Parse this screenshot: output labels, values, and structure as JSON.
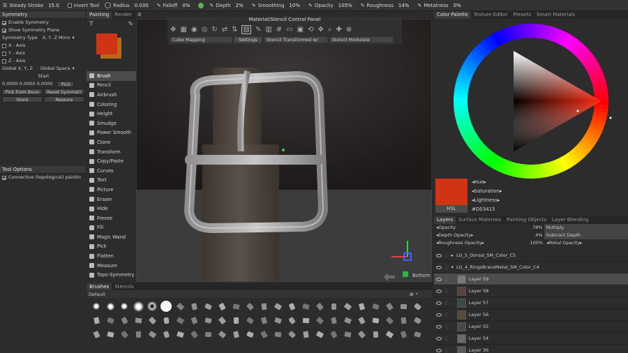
{
  "topbar": {
    "steady_stroke": "Steady Stroke",
    "steady_value": "15.0",
    "invert_tool": "Invert Tool",
    "radius_label": "Radius",
    "radius_value": "0.030",
    "falloff_label": "Falloff",
    "falloff_value": "0%",
    "depth_label": "Depth",
    "depth_value": "2%",
    "smoothing_label": "Smoothing",
    "smoothing_value": "10%",
    "opacity_label": "Opacity",
    "opacity_value": "105%",
    "roughness_label": "Roughness",
    "roughness_value": "14%",
    "metalness_label": "Metalness",
    "metalness_value": "0%"
  },
  "symmetry": {
    "title": "Symmetry",
    "enable": "Enable Symmetry",
    "show_plane": "Show Symmetry Plane",
    "type_label": "Symmetry Type",
    "type_value": "X, Y, Z Mirro",
    "x_axis": "X - Axis",
    "y_axis": "Y - Axis",
    "z_axis": "Z - Axis",
    "global_label": "Global X, Y, Z",
    "global_space": "Global Space",
    "start": "Start",
    "coords": "0.0000 0.0000 0.0000",
    "pick": "Pick",
    "pick_from_bounds": "Pick from Boun",
    "reset_symmetry": "Reset Symmetr",
    "store": "Store",
    "restore": "Restore"
  },
  "tool_options": {
    "title": "Tool Options",
    "connective": "Connective (topological) paintin"
  },
  "room_tabs": [
    "Painting",
    "Render"
  ],
  "tools": [
    "Brush",
    "Pencil",
    "Airbrush",
    "Coloring",
    "Height",
    "Smudge",
    "Power Smooth",
    "Clone",
    "Transform",
    "Copy/Paste",
    "Curves",
    "Text",
    "Picture",
    "Eraser",
    "Hide",
    "Freeze",
    "Fill",
    "Magic Wand",
    "Pick",
    "Flatten",
    "Measure",
    "Topo-Symmetry"
  ],
  "stencil": {
    "title": "Material/Stencil Control Panel",
    "mapping": "Cube Mapping",
    "settings": "Settings",
    "transformed": "Stencil Transformed w/",
    "modulate": "Stencil Modulate"
  },
  "viewport": {
    "bottom_label": "Bottom"
  },
  "brushes": {
    "tabs": [
      "Brushes",
      "Stencils"
    ],
    "preset": "Default"
  },
  "color_panel": {
    "tabs": [
      "Color Palette",
      "Texture Editor",
      "Presets",
      "Smart Materials"
    ],
    "hue": "Hue",
    "saturation": "Saturation",
    "lightness": "Lightness",
    "mode": "HSL",
    "hex": "#D03415",
    "current_color": "#d03415"
  },
  "layers_panel": {
    "tabs": [
      "Layers",
      "Surface Materials",
      "Painting Objects",
      "Layer Blending"
    ],
    "opacity_label": "Opacity",
    "opacity_value": "78%",
    "blend_mode": "Multiply",
    "depth_opacity_label": "Depth Opacity",
    "depth_opacity_value": "4%",
    "depth_mode": "Subtract Depth",
    "roughness_opacity_label": "Roughness Opacity",
    "roughness_opacity_value": "100%",
    "metal_opacity": "Metal Opacity",
    "groups": [
      "LG_5_Dorsal_SM_Color_C5",
      "LG_4_RingsBraceMetal_SM_Color_C4"
    ],
    "layers": [
      "Layer 59",
      "Layer 58",
      "Layer 57",
      "Layer 56",
      "Layer 55",
      "Layer 54",
      "Layer 36"
    ]
  }
}
